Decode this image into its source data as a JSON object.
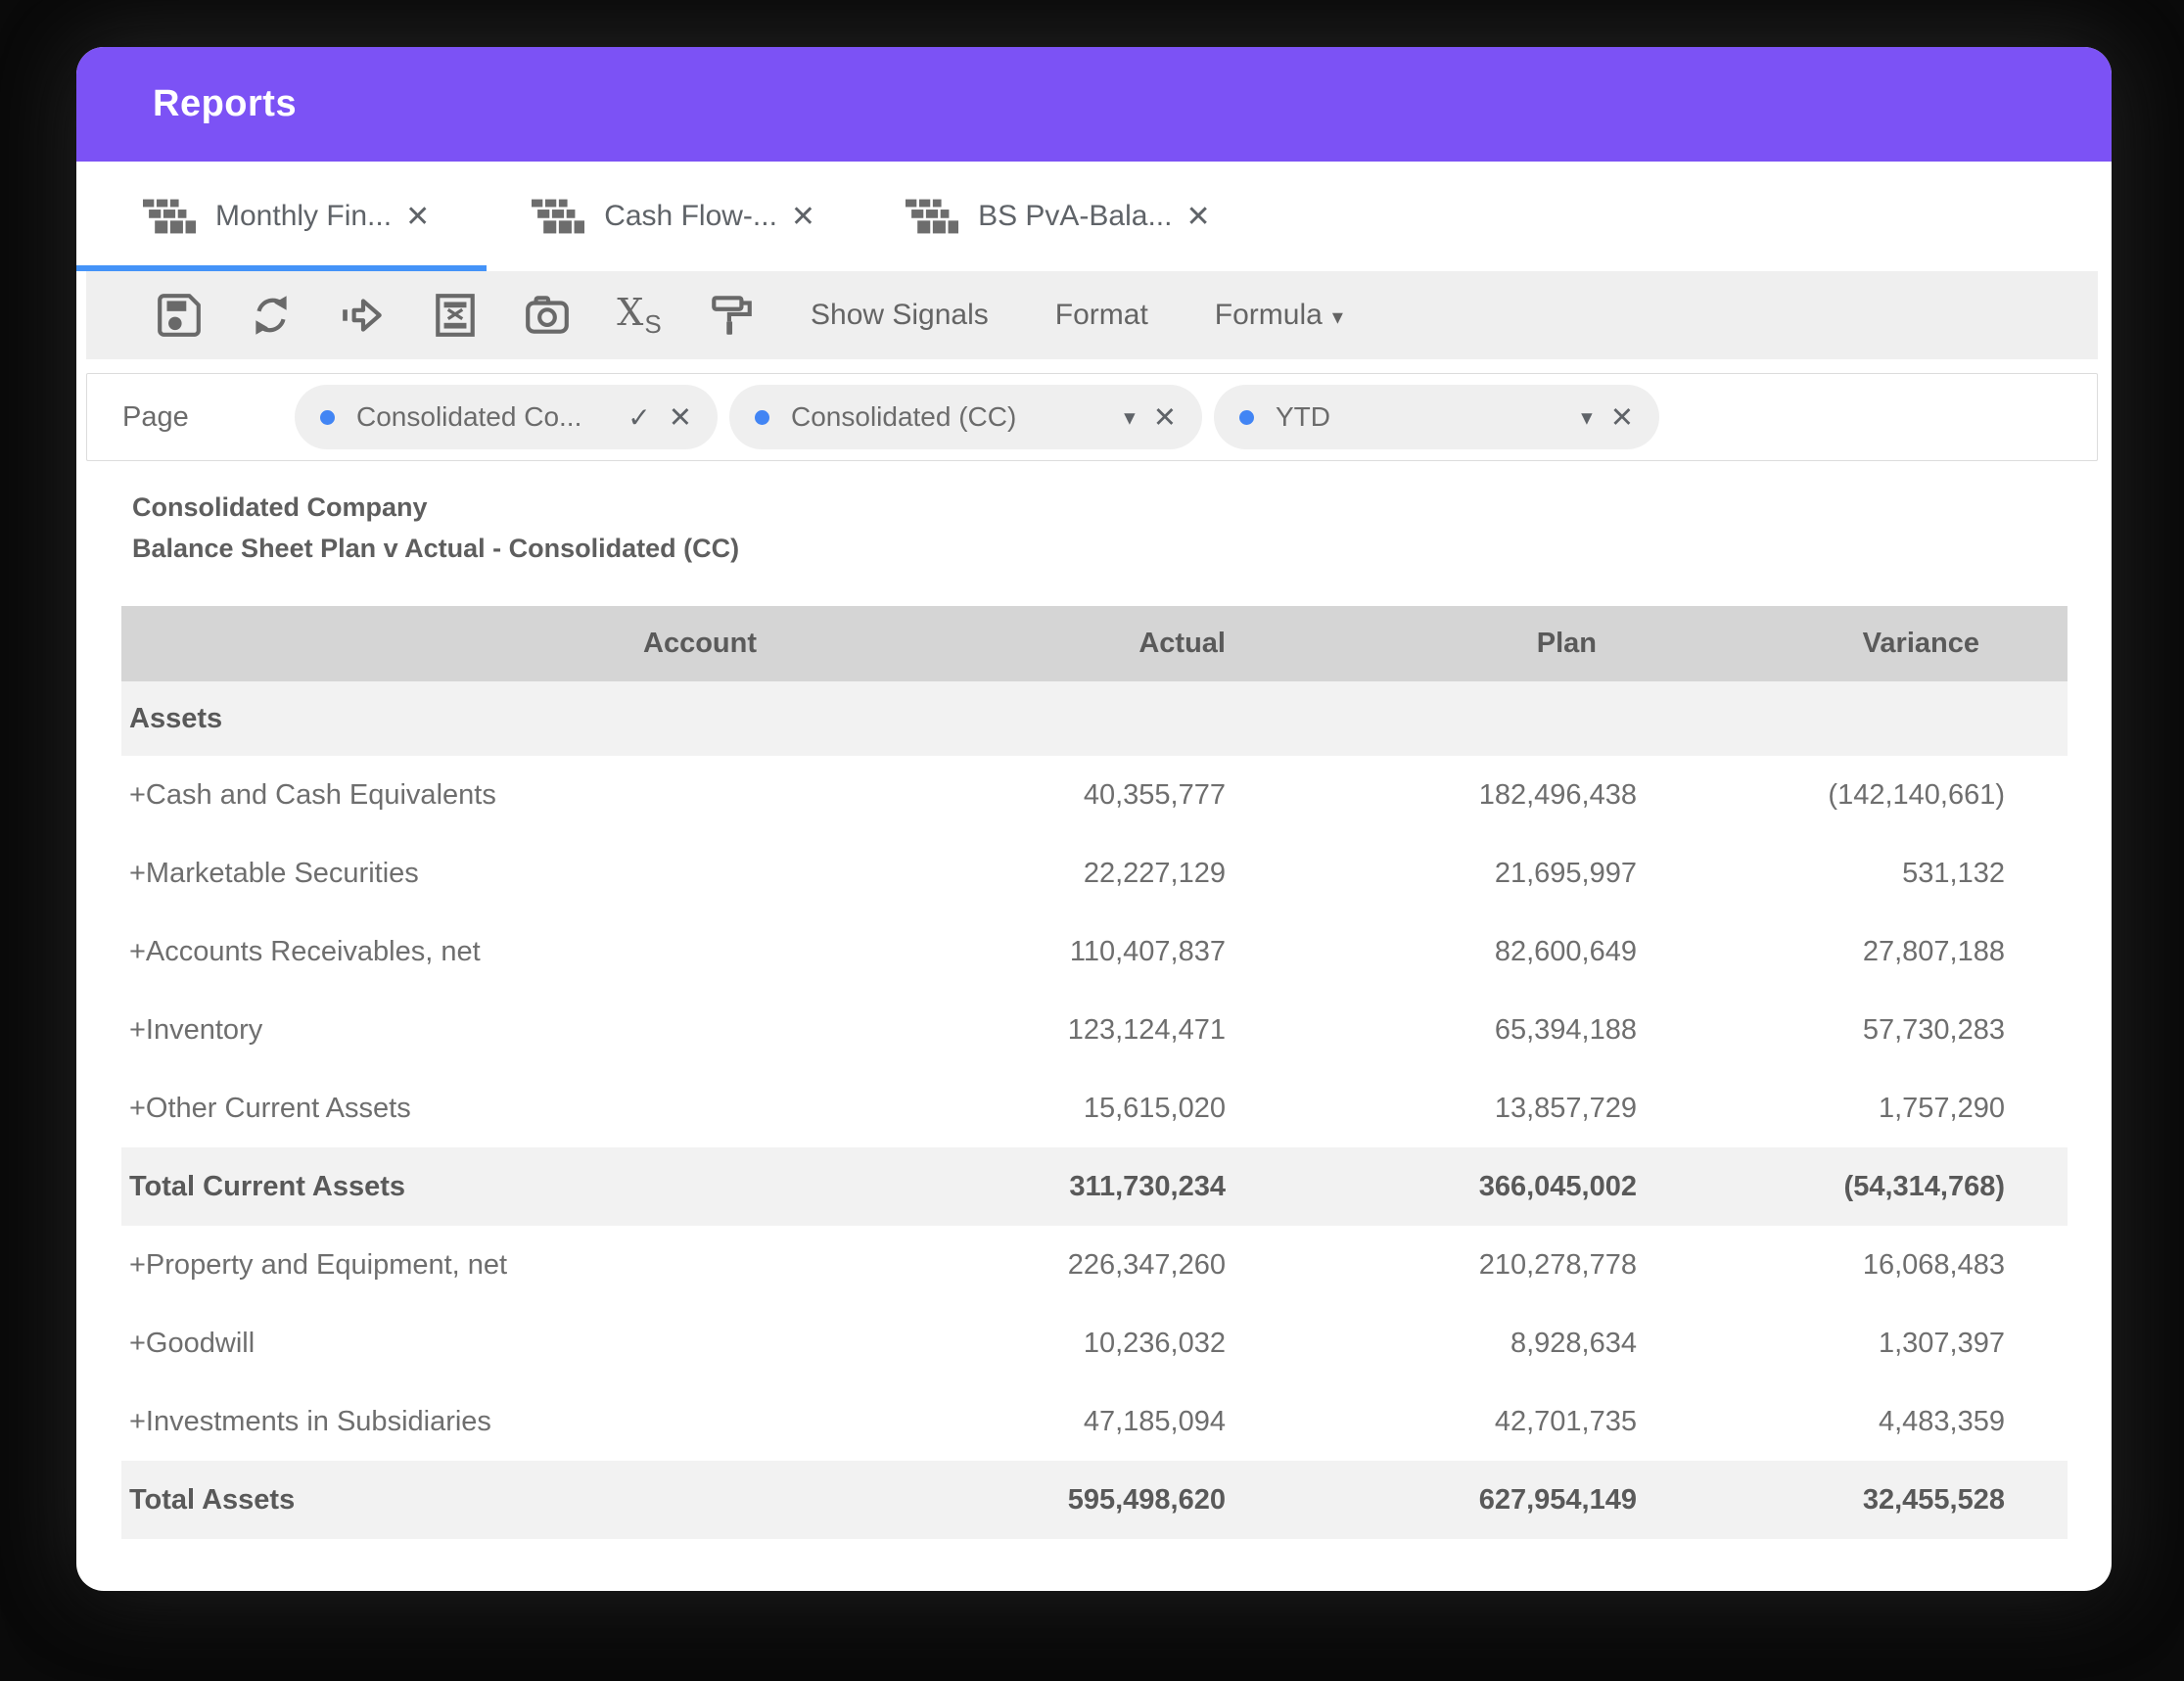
{
  "window": {
    "title": "Reports"
  },
  "glyphs": {
    "close": "✕",
    "check": "✓",
    "caret": "▾"
  },
  "colors": {
    "header_purple": "#7C52F5",
    "active_tab_blue": "#4493F8",
    "pill_dot_blue": "#4285F4",
    "toolbar_gray": "#efefef",
    "table_header_gray": "#d5d5d5",
    "band_gray": "#f2f2f2",
    "text_gray": "#6e6e6e"
  },
  "tabs": [
    {
      "label": "Monthly Fin...",
      "active": true
    },
    {
      "label": "Cash Flow-...",
      "active": false
    },
    {
      "label": "BS PvA-Bala...",
      "active": false
    }
  ],
  "toolbar": {
    "icons": [
      "save",
      "refresh",
      "export",
      "clear",
      "snapshot",
      "scale-xs",
      "format-painter"
    ],
    "scale_icon": {
      "base": "X",
      "sub": "S"
    },
    "buttons": [
      {
        "label": "Show Signals",
        "caret": false
      },
      {
        "label": "Format",
        "caret": false
      },
      {
        "label": "Formula",
        "caret": true
      }
    ]
  },
  "filters": {
    "label": "Page",
    "pills": [
      {
        "label": "Consolidated Co...",
        "mid_icon": "check"
      },
      {
        "label": "Consolidated (CC)",
        "mid_icon": "caret"
      },
      {
        "label": "YTD",
        "mid_icon": "caret"
      }
    ]
  },
  "report": {
    "company": "Consolidated Company",
    "title": "Balance Sheet Plan v Actual - Consolidated (CC)"
  },
  "table": {
    "columns": [
      "Account",
      "Actual",
      "Plan",
      "Variance"
    ],
    "rows": [
      {
        "type": "section",
        "label": "Assets",
        "actual": "",
        "plan": "",
        "variance": ""
      },
      {
        "type": "data",
        "label": "+Cash and Cash Equivalents",
        "actual": "40,355,777",
        "plan": "182,496,438",
        "variance": "(142,140,661)"
      },
      {
        "type": "data",
        "label": "+Marketable Securities",
        "actual": "22,227,129",
        "plan": "21,695,997",
        "variance": "531,132"
      },
      {
        "type": "data",
        "label": "+Accounts Receivables, net",
        "actual": "110,407,837",
        "plan": "82,600,649",
        "variance": "27,807,188"
      },
      {
        "type": "data",
        "label": "+Inventory",
        "actual": "123,124,471",
        "plan": "65,394,188",
        "variance": "57,730,283"
      },
      {
        "type": "data",
        "label": "+Other Current Assets",
        "actual": "15,615,020",
        "plan": "13,857,729",
        "variance": "1,757,290"
      },
      {
        "type": "total",
        "label": "Total Current Assets",
        "actual": "311,730,234",
        "plan": "366,045,002",
        "variance": "(54,314,768)"
      },
      {
        "type": "data",
        "label": "+Property and Equipment, net",
        "actual": "226,347,260",
        "plan": "210,278,778",
        "variance": "16,068,483"
      },
      {
        "type": "data",
        "label": "+Goodwill",
        "actual": "10,236,032",
        "plan": "8,928,634",
        "variance": "1,307,397"
      },
      {
        "type": "data",
        "label": "+Investments in Subsidiaries",
        "actual": "47,185,094",
        "plan": "42,701,735",
        "variance": "4,483,359"
      },
      {
        "type": "total",
        "label": "Total Assets",
        "actual": "595,498,620",
        "plan": "627,954,149",
        "variance": "32,455,528"
      }
    ]
  }
}
